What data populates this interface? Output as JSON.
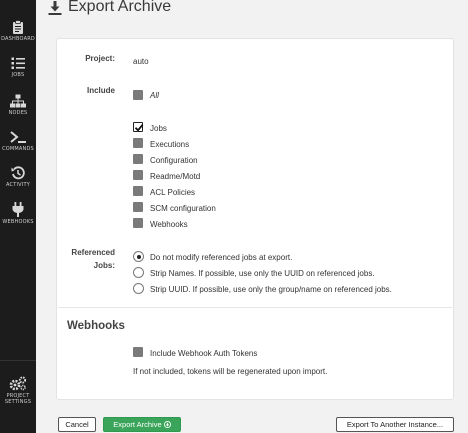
{
  "sidebar": {
    "items": [
      {
        "label": "DASHBOARD",
        "icon": "clipboard-icon"
      },
      {
        "label": "JOBS",
        "icon": "job-list-icon"
      },
      {
        "label": "NODES",
        "icon": "sitemap-icon"
      },
      {
        "label": "COMMANDS",
        "icon": "terminal-icon"
      },
      {
        "label": "ACTIVITY",
        "icon": "history-icon"
      },
      {
        "label": "WEBHOOKS",
        "icon": "plug-icon"
      }
    ],
    "settings": {
      "label_line1": "PROJECT",
      "label_line2": "SETTINGS",
      "icon": "gears-icon"
    }
  },
  "page": {
    "title": "Export Archive"
  },
  "form": {
    "project_label": "Project:",
    "project_value": "auto",
    "include_label": "Include",
    "include_options": [
      {
        "label": "All",
        "checked": false
      },
      {
        "label": "Jobs",
        "checked": true
      },
      {
        "label": "Executions",
        "checked": false
      },
      {
        "label": "Configuration",
        "checked": false
      },
      {
        "label": "Readme/Motd",
        "checked": false
      },
      {
        "label": "ACL Policies",
        "checked": false
      },
      {
        "label": "SCM configuration",
        "checked": false
      },
      {
        "label": "Webhooks",
        "checked": false
      }
    ],
    "referenced_label_line1": "Referenced",
    "referenced_label_line2": "Jobs:",
    "referenced_options": [
      {
        "label": "Do not modify referenced jobs at export.",
        "selected": true
      },
      {
        "label": "Strip Names. If possible, use only the UUID on referenced jobs.",
        "selected": false
      },
      {
        "label": "Strip UUID. If possible, use only the group/name on referenced jobs.",
        "selected": false
      }
    ]
  },
  "webhooks": {
    "title": "Webhooks",
    "include_tokens_label": "Include Webhook Auth Tokens",
    "include_tokens_checked": false,
    "help_text": "If not included, tokens will be regenerated upon import."
  },
  "buttons": {
    "cancel": "Cancel",
    "export": "Export Archive",
    "export_other": "Export To Another Instance..."
  },
  "colors": {
    "sidebar_bg": "#1c1c1c",
    "success": "#3aa55a",
    "checkbox_gray": "#7a7a7a"
  }
}
